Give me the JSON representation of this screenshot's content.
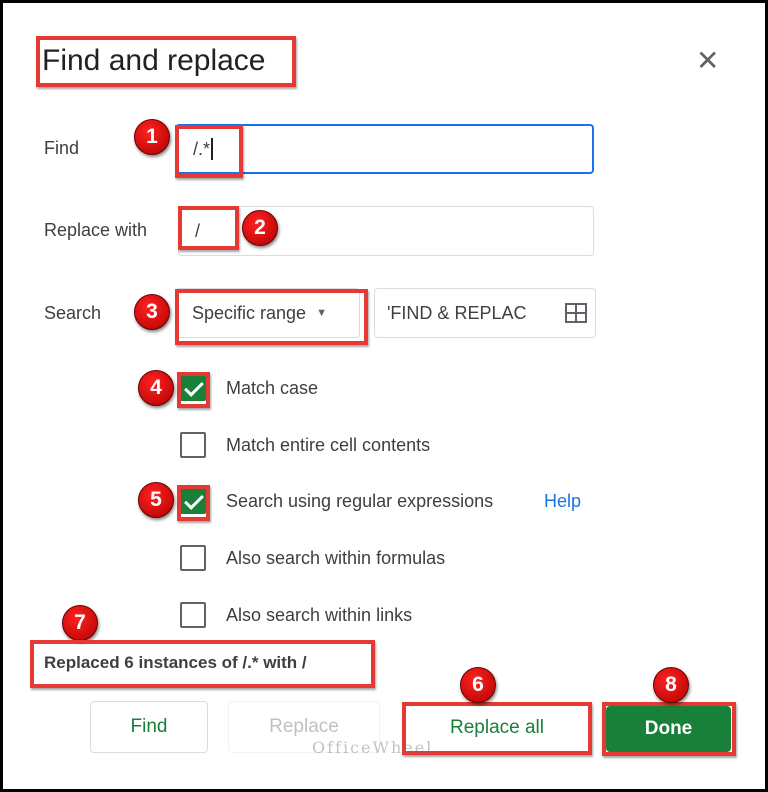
{
  "dialog": {
    "title": "Find and replace",
    "close_icon": "close-icon"
  },
  "find": {
    "label": "Find",
    "value": "/.*"
  },
  "replace": {
    "label": "Replace with",
    "value": "/"
  },
  "search": {
    "label": "Search",
    "scope": "Specific range",
    "range": "'FIND & REPLAC",
    "range_icon": "grid-icon"
  },
  "options": [
    {
      "label": "Match case",
      "checked": true
    },
    {
      "label": "Match entire cell contents",
      "checked": false
    },
    {
      "label": "Search using regular expressions",
      "checked": true
    },
    {
      "label": "Also search within formulas",
      "checked": false
    },
    {
      "label": "Also search within links",
      "checked": false
    }
  ],
  "help_link": "Help",
  "status": "Replaced 6 instances of /.* with /",
  "buttons": {
    "find": "Find",
    "replace": "Replace",
    "replace_all": "Replace all",
    "done": "Done"
  },
  "badges": [
    "1",
    "2",
    "3",
    "4",
    "5",
    "6",
    "7",
    "8"
  ],
  "watermark": "OfficeWheel",
  "colors": {
    "accent": "#188038",
    "focus": "#1a73e8",
    "highlight": "#e53935",
    "link": "#1a73e8"
  }
}
